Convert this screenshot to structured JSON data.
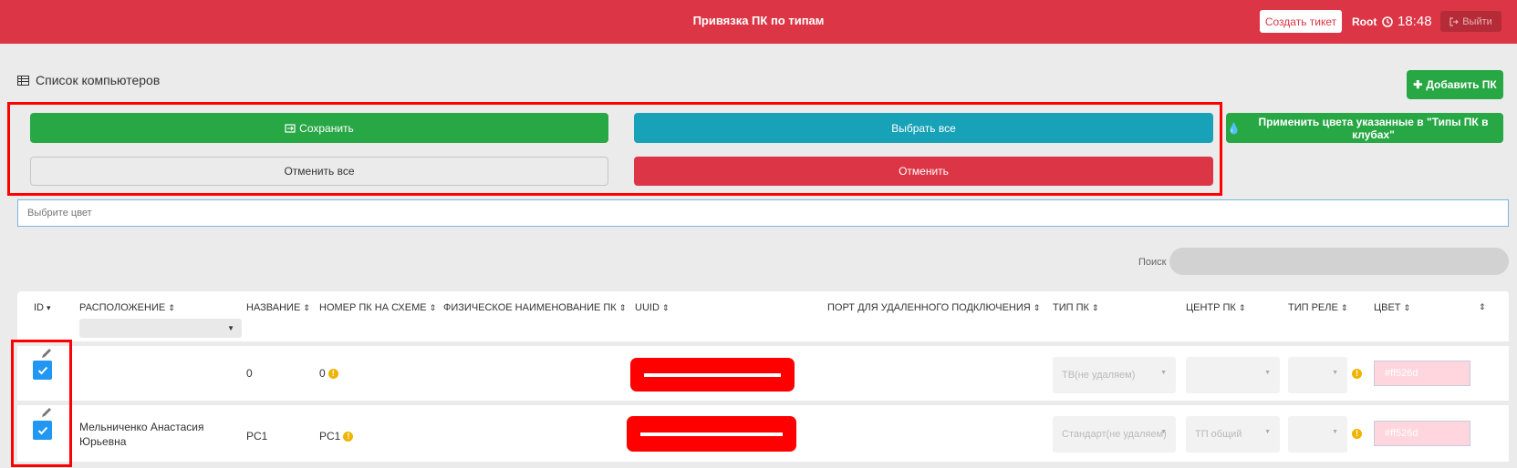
{
  "header": {
    "title": "Привязка ПК по типам",
    "create_ticket": "Создать тикет",
    "user": "Root",
    "time": "18:48",
    "logout": "Выйти",
    "accent_color": "#dc3545"
  },
  "page": {
    "list_title": "Список компьютеров",
    "add_pc": "Добавить ПК",
    "save": "Сохранить",
    "select_all": "Выбрать все",
    "apply_colors": "Применить цвета указанные в \"Типы ПК в клубах\"",
    "cancel_all": "Отменить все",
    "cancel": "Отменить",
    "color_placeholder": "Выбрите цвет",
    "search_label": "Поиск"
  },
  "table": {
    "columns": [
      "ID",
      "РАСПОЛОЖЕНИЕ",
      "НАЗВАНИЕ",
      "НОМЕР ПК НА СХЕМЕ",
      "ФИЗИЧЕСКОЕ НАИМЕНОВАНИЕ ПК",
      "UUID",
      "ПОРТ ДЛЯ УДАЛЕННОГО ПОДКЛЮЧЕНИЯ",
      "ТИП ПК",
      "ЦЕНТР ПК",
      "ТИП РЕЛЕ",
      "ЦВЕТ"
    ],
    "rows": [
      {
        "location_line1": "",
        "location_line2": "",
        "name": "0",
        "scheme_number": "0",
        "pc_type": "ТВ(не удаляем)",
        "pc_center": "",
        "relay_type": "",
        "color": "#ff526d",
        "checked": true
      },
      {
        "location_line1": "Мельниченко Анастасия",
        "location_line2": "Юрьевна",
        "name": "PC1",
        "scheme_number": "PC1",
        "pc_type": "Стандарт(не удаляем)",
        "pc_center": "ТП общий",
        "relay_type": "",
        "color": "#ff526d",
        "checked": true
      }
    ]
  }
}
